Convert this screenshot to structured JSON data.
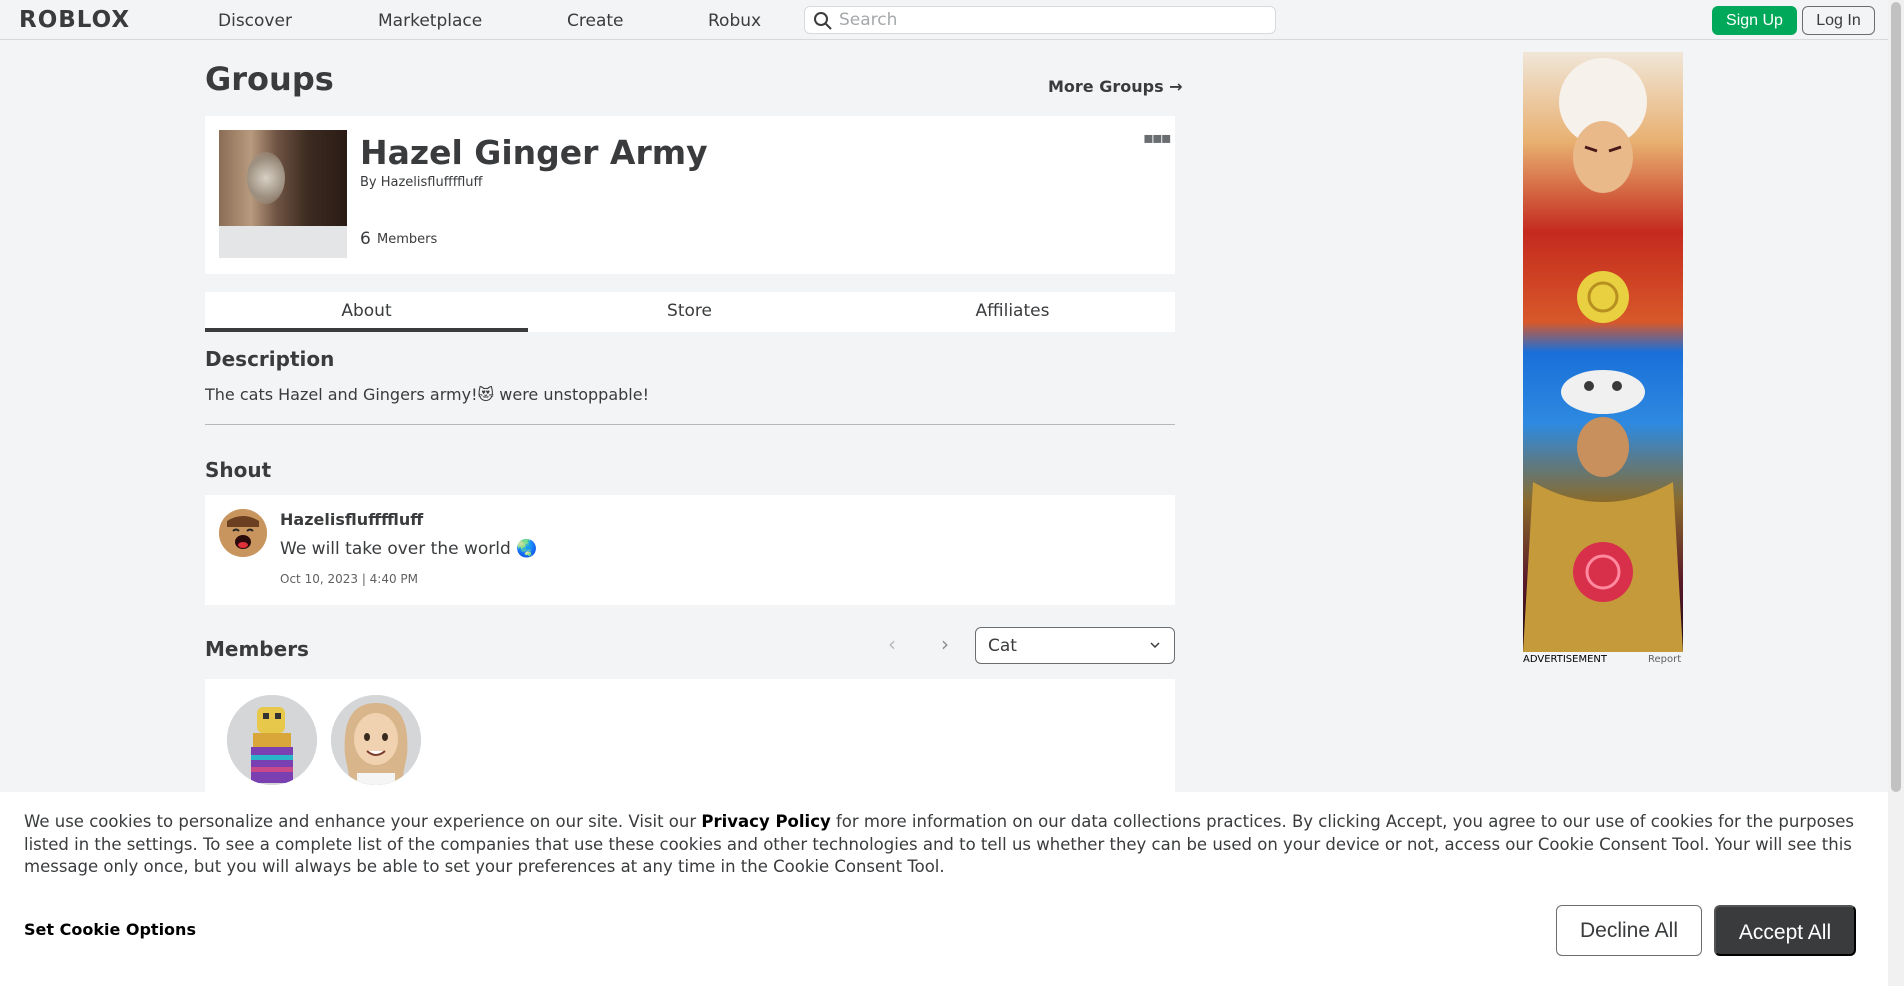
{
  "nav": {
    "logo": "RΟBLOX",
    "links": [
      "Discover",
      "Marketplace",
      "Create",
      "Robux"
    ],
    "search_placeholder": "Search",
    "signup": "Sign Up",
    "login": "Log In"
  },
  "page": {
    "title": "Groups",
    "more_groups": "More Groups →"
  },
  "group": {
    "name": "Hazel Ginger Army",
    "by": "By Hazelisfluffffluff",
    "members_count": "6",
    "members_label": "Members",
    "more": "▪▪▪"
  },
  "tabs": [
    {
      "label": "About",
      "active": true
    },
    {
      "label": "Store",
      "active": false
    },
    {
      "label": "Affiliates",
      "active": false
    }
  ],
  "description": {
    "title": "Description",
    "text": "The cats Hazel and Gingers army!😻 were unstoppable!"
  },
  "shout": {
    "title": "Shout",
    "user": "Hazelisfluffffluff",
    "message": "We will take over the world 🌏",
    "date": "Oct 10, 2023 | 4:40 PM"
  },
  "members": {
    "title": "Members",
    "prev": "‹",
    "next": "›",
    "role": "Cat"
  },
  "ad": {
    "label": "ADVERTISEMENT",
    "report": "Report"
  },
  "cookie": {
    "text_before": "We use cookies to personalize and enhance your experience on our site. Visit our ",
    "link": "Privacy Policy",
    "text_after": " for more information on our data collections practices. By clicking Accept, you agree to our use of cookies for the purposes listed in the settings. To see a complete list of the companies that use these cookies and other technologies and to tell us whether they can be used on your device or not, access our Cookie Consent Tool. Your will see this message only once, but you will always be able to set your preferences at any time in the Cookie Consent Tool.",
    "options": "Set Cookie Options",
    "decline": "Decline All",
    "accept": "Accept All"
  },
  "colors": {
    "accent_green": "#00a85a",
    "dark_button": "#393b3d",
    "background": "#f2f4f5"
  }
}
